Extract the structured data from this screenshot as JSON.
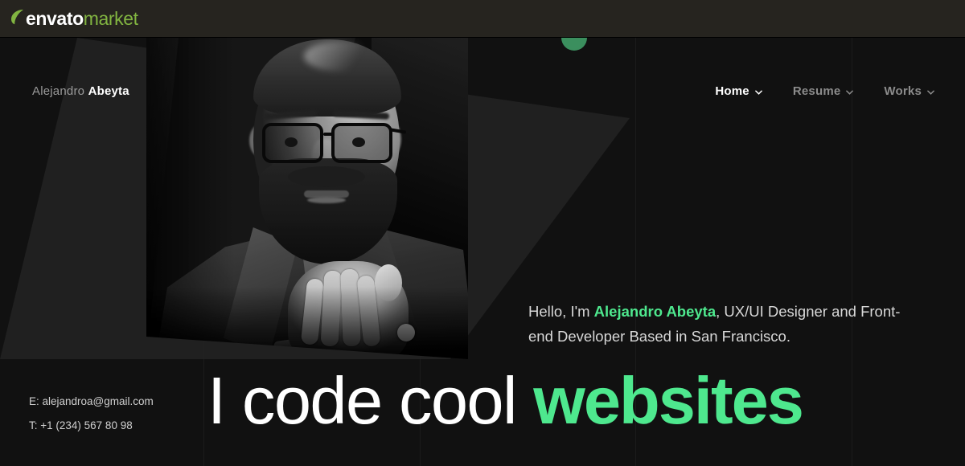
{
  "envato_bar": {
    "logo_leaf": "envato-leaf-icon",
    "logo_primary": "envato",
    "logo_secondary": "market"
  },
  "hero": {
    "brand": {
      "first_name": "Alejandro",
      "last_name": "Abeyta"
    },
    "nav": [
      {
        "label": "Home",
        "active": true,
        "icon": "chevron-down-icon"
      },
      {
        "label": "Resume",
        "active": false,
        "icon": "chevron-down-icon"
      },
      {
        "label": "Works",
        "active": false,
        "icon": "chevron-down-icon"
      }
    ],
    "intro": {
      "before": "Hello, I'm ",
      "highlight": "Alejandro Abeyta",
      "after": ", UX/UI Designer and Front-end Developer Based in San Francisco."
    },
    "headline": {
      "plain": "I code cool ",
      "accent": "websites"
    },
    "contact": {
      "email_label": "E: alejandroa@gmail.com",
      "phone_label": "T: +1 (234) 567 80 98"
    },
    "portrait_alt": "black-and-white portrait of bearded man with glasses, hands clasped"
  },
  "colors": {
    "accent_green": "#4ee88e",
    "envato_green": "#82b541",
    "dot_green": "#3b8f5e",
    "bar_background": "#26241f",
    "page_background": "#111111",
    "nav_inactive": "#8c8c8c"
  }
}
